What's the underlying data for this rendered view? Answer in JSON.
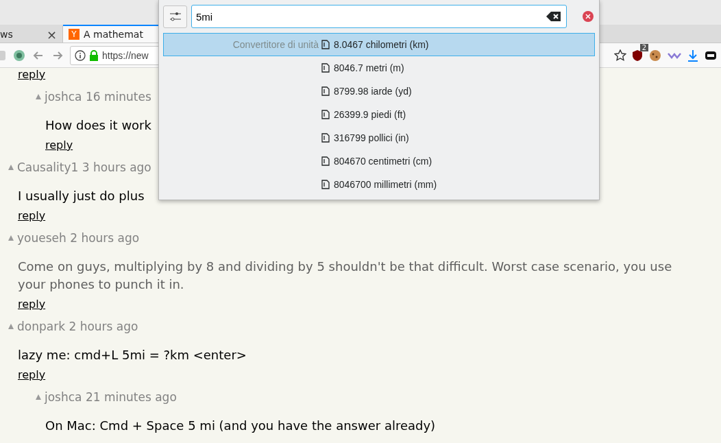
{
  "browser": {
    "tabs": [
      {
        "title": "ws",
        "selected": false,
        "close": "×"
      },
      {
        "title": "A mathemat",
        "favicon": "Y",
        "selected": true
      }
    ],
    "url": "https://new",
    "extension_badge": "2"
  },
  "launcher": {
    "query": "5mi",
    "results": [
      {
        "category": "Convertitore di unità",
        "text": "8.0467 chilometri (km)",
        "selected": true
      },
      {
        "text": "8046.7 metri (m)",
        "selected": false
      },
      {
        "text": "8799.98 iarde (yd)",
        "selected": false
      },
      {
        "text": "26399.9 piedi (ft)",
        "selected": false
      },
      {
        "text": "316799 pollici (in)",
        "selected": false
      },
      {
        "text": "804670 centimetri (cm)",
        "selected": false
      },
      {
        "text": "8046700 millimetri (mm)",
        "selected": false
      }
    ]
  },
  "comments": [
    {
      "reply": "reply",
      "children": [
        {
          "meta": "joshca 16 minutes",
          "lines": [
            "How does it work"
          ],
          "faded": false,
          "reply": "reply"
        }
      ]
    },
    {
      "meta": "Causality1 3 hours ago",
      "lines": [
        "I usually just do plus"
      ],
      "faded": false,
      "reply": "reply"
    },
    {
      "meta": "youeseh 2 hours ago",
      "lines": [
        "Come on guys, multiplying by 8 and dividing by 5 shouldn't be that difficult. Worst case scenario, you use",
        "your phones to punch it in."
      ],
      "faded": true,
      "reply": "reply"
    },
    {
      "meta": "donpark 2 hours ago",
      "lines": [
        "lazy me: cmd+L 5mi = ?km <enter>"
      ],
      "faded": false,
      "reply": "reply",
      "children": [
        {
          "meta": "joshca 21 minutes ago",
          "lines": [
            "On Mac: Cmd + Space 5 mi (and you have the answer already)"
          ],
          "faded": false
        }
      ]
    }
  ]
}
